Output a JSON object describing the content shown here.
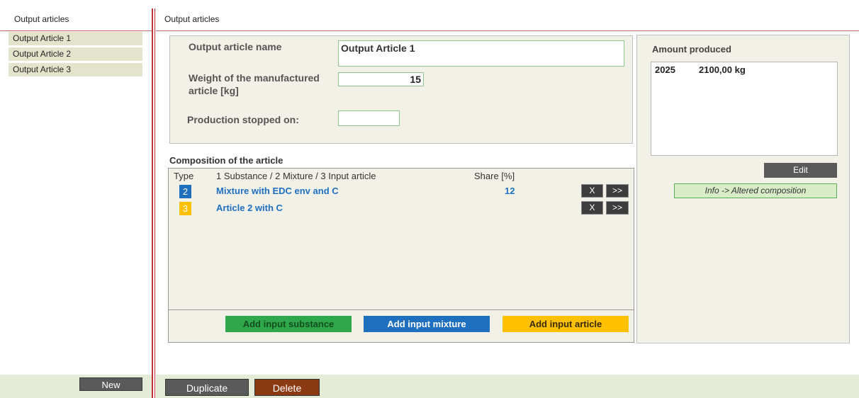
{
  "left_panel": {
    "header": "Output articles",
    "items": [
      {
        "label": "Output Article 1"
      },
      {
        "label": "Output Article 2"
      },
      {
        "label": "Output Article 3"
      }
    ],
    "new_label": "New"
  },
  "main": {
    "header": "Output articles",
    "form": {
      "name_label": "Output article name",
      "name_value": "Output Article 1",
      "weight_label_line1": "Weight of the manufactured",
      "weight_label_line2": "article [kg]",
      "weight_value": "15",
      "stopped_label": "Production stopped on:",
      "stopped_value": ""
    },
    "composition": {
      "title": "Composition of the article",
      "col_type": "Type",
      "col_kind": "1 Substance / 2 Mixture / 3 Input article",
      "col_share": "Share [%]",
      "rows": [
        {
          "type": "2",
          "name": "Mixture with EDC env and C",
          "share": "12",
          "remove": "X",
          "open": ">>"
        },
        {
          "type": "3",
          "name": "Article 2 with C",
          "share": "",
          "remove": "X",
          "open": ">>"
        }
      ],
      "add_substance": "Add input substance",
      "add_mixture": "Add input mixture",
      "add_article": "Add input article"
    },
    "amount": {
      "title": "Amount produced",
      "year": "2025",
      "value": "2100,00 kg",
      "edit_label": "Edit",
      "info_label": "Info -> Altered composition"
    },
    "duplicate_label": "Duplicate",
    "delete_label": "Delete"
  },
  "colors": {
    "type2": "#1f6fbf",
    "type3": "#ffc000",
    "add_substance": "#2ea84a",
    "add_mixture": "#1f6fbf",
    "add_article": "#ffc000",
    "divider": "#c0303a"
  }
}
